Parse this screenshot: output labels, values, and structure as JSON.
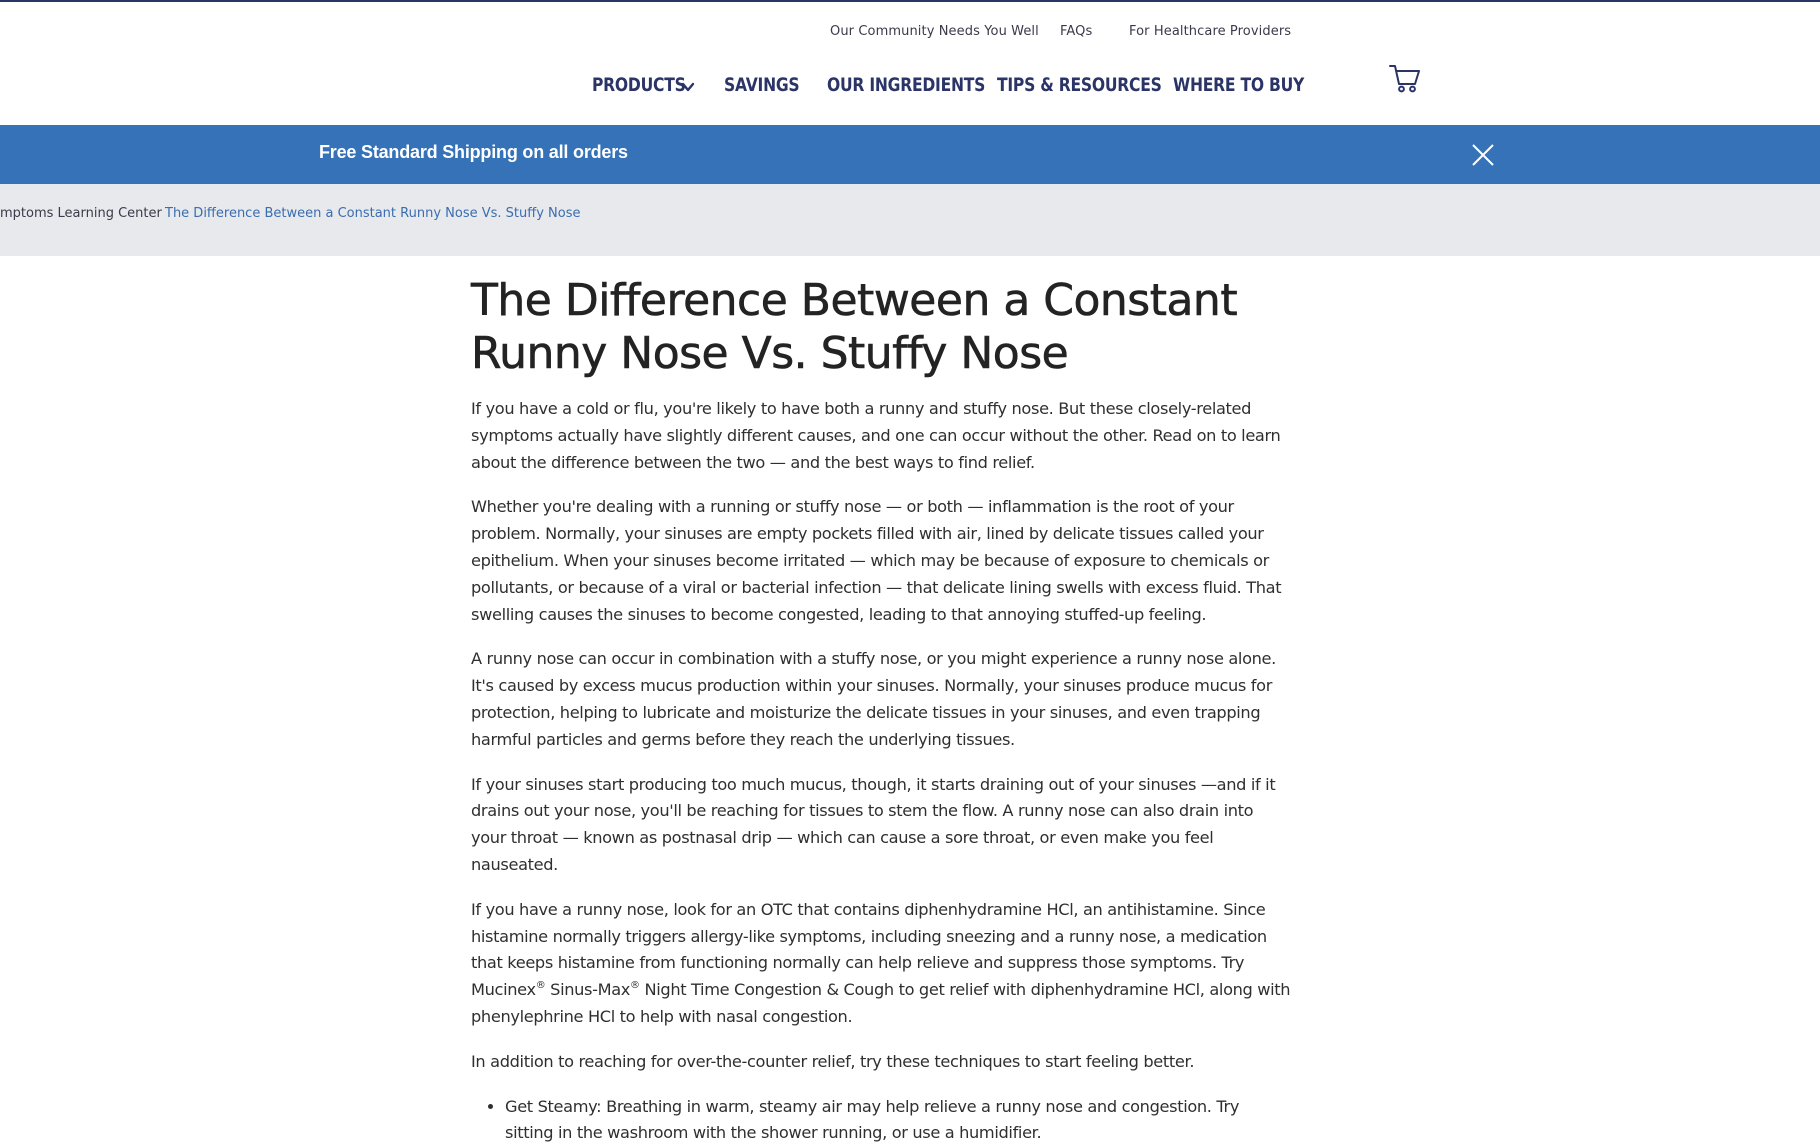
{
  "utility_nav": [
    "Our Community Needs You Well",
    "FAQs",
    "For Healthcare Providers"
  ],
  "main_nav": [
    "PRODUCTS",
    "SAVINGS",
    "OUR INGREDIENTS",
    "TIPS & RESOURCES",
    "WHERE TO BUY"
  ],
  "banner": {
    "message": "Free Standard Shipping on all orders"
  },
  "breadcrumb": [
    "mptoms Learning Center",
    "The Difference Between a Constant Runny Nose Vs. Stuffy Nose"
  ],
  "article": {
    "title_line1": "The Difference Between a Constant",
    "title_line2": "Runny Nose Vs. Stuffy Nose",
    "p1": "If you have a cold or flu, you're likely to have both a runny and stuffy nose. But these closely-related symptoms actually have slightly different causes, and one can occur without the other. Read on to learn about the difference between the two — and the best ways to find relief.",
    "p2": "Whether you're dealing with a running or stuffy nose — or both — inflammation is the root of your problem. Normally, your sinuses are empty pockets filled with air, lined by delicate tissues called your epithelium. When your sinuses become irritated — which may be because of exposure to chemicals or pollutants, or because of a viral or bacterial infection — that delicate lining swells with excess fluid. That swelling causes the sinuses to become congested, leading to that annoying stuffed-up feeling.",
    "p3": "A runny nose can occur in combination with a stuffy nose, or you might experience a runny nose alone. It's caused by excess mucus production within your sinuses. Normally, your sinuses produce mucus for protection, helping to lubricate and moisturize the delicate tissues in your sinuses, and even trapping harmful particles and germs before they reach the underlying tissues.",
    "p4": "If your sinuses start producing too much mucus, though, it starts draining out of your sinuses —and if it drains out your nose, you'll be reaching for tissues to stem the flow. A runny nose can also drain into your throat — known as postnasal drip — which can cause a sore throat, or even make you feel nauseated.",
    "p5_a": "If you have a runny nose, look for an OTC that contains diphenhydramine HCl, an antihistamine. Since histamine normally triggers allergy-like symptoms, including sneezing and a runny nose, a medication that keeps histamine from functioning normally can help relieve and suppress those symptoms. Try Mucinex",
    "p5_b": " Sinus-Max",
    "p5_c": " Night Time Congestion & Cough to get relief with diphenhydramine HCl, along with phenylephrine HCl to help with nasal congestion.",
    "reg": "®",
    "p6": "In addition to reaching for over-the-counter relief, try these techniques to start feeling better.",
    "bullet1": "Get Steamy: Breathing in warm, steamy air may help relieve a runny nose and congestion. Try sitting in the washroom with the shower running, or use a humidifier."
  },
  "icons": {
    "cart": "shopping-cart-icon",
    "close": "close-icon",
    "chevron": "chevron-down-icon"
  },
  "colors": {
    "navy": "#2a3467",
    "banner": "#3572b8",
    "crumb_bg": "#e7e9ec",
    "link": "#3a6db0"
  }
}
